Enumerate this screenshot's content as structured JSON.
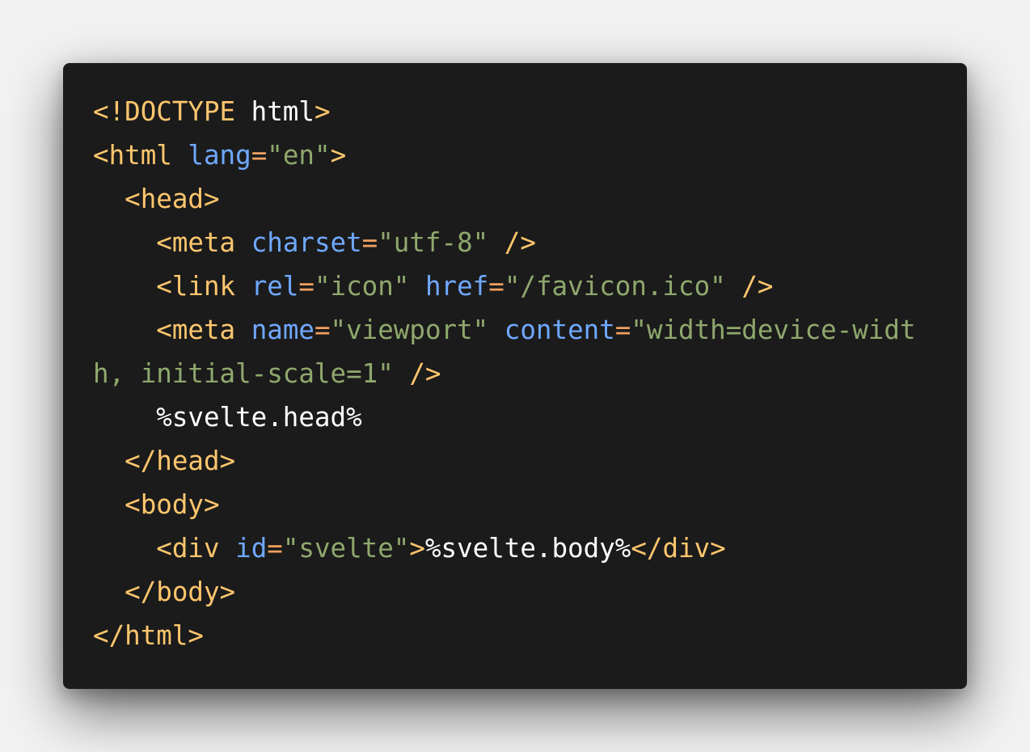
{
  "theme": {
    "background": "#1b1b1b",
    "tag": "#ffc66d",
    "attribute": "#6fa8ff",
    "string": "#8fa86d",
    "text": "#ffffff"
  },
  "code": {
    "l1": {
      "a": "<!DOCTYPE",
      "b": " html",
      "c": ">"
    },
    "l2": {
      "a": "<html",
      "b": " ",
      "c": "lang",
      "d": "=",
      "e": "\"en\"",
      "f": ">"
    },
    "l3": {
      "a": "  <head>"
    },
    "l4": {
      "a": "    <meta",
      "b": " ",
      "c": "charset",
      "d": "=",
      "e": "\"utf-8\"",
      "f": " />"
    },
    "l5": {
      "a": "    <link",
      "b": " ",
      "c": "rel",
      "d": "=",
      "e": "\"icon\"",
      "f": " ",
      "g": "href",
      "h": "=",
      "i": "\"/favicon.ico\"",
      "j": " />"
    },
    "l6": {
      "a": "    <meta",
      "b": " ",
      "c": "name",
      "d": "=",
      "e": "\"viewport\"",
      "f": " ",
      "g": "content",
      "h": "=",
      "i": "\"width=device-widt"
    },
    "l7": {
      "a": "h, initial-scale=1\"",
      "b": " />"
    },
    "l8": {
      "a": "    %svelte.head%"
    },
    "l9": {
      "a": "  </head>"
    },
    "l10": {
      "a": "  <body>"
    },
    "l11": {
      "a": "    <div",
      "b": " ",
      "c": "id",
      "d": "=",
      "e": "\"svelte\"",
      "f": ">",
      "g": "%svelte.body%",
      "h": "</div>"
    },
    "l12": {
      "a": "  </body>"
    },
    "l13": {
      "a": "</html>"
    }
  }
}
